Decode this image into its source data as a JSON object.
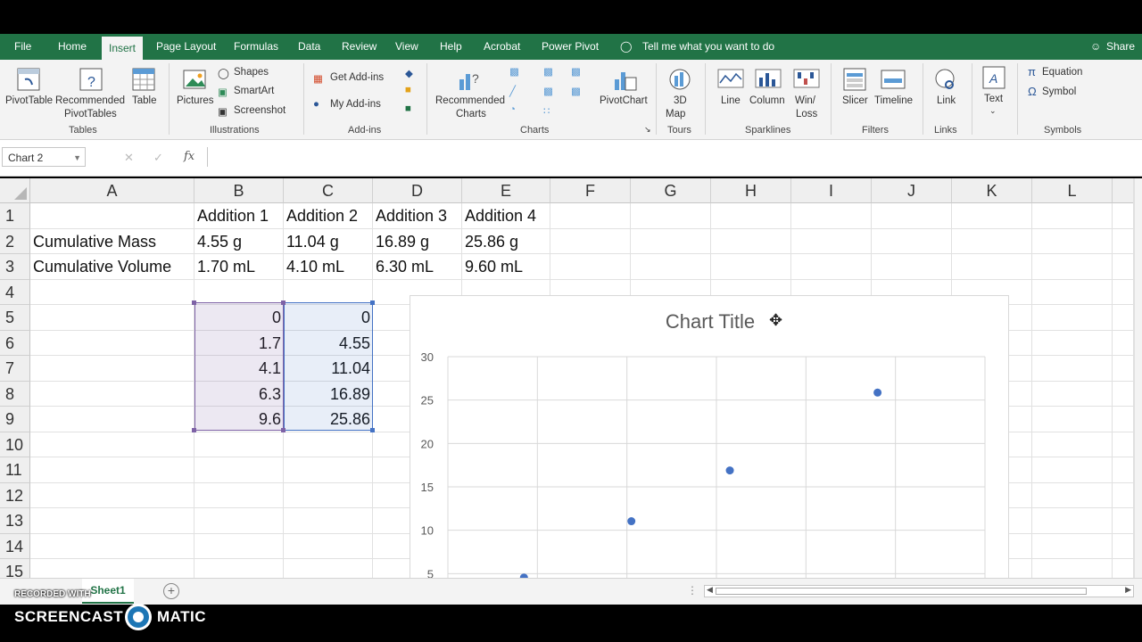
{
  "tabs": [
    "File",
    "Home",
    "Insert",
    "Page Layout",
    "Formulas",
    "Data",
    "Review",
    "View",
    "Help",
    "Acrobat",
    "Power Pivot"
  ],
  "active_tab": "Insert",
  "tell_me": "Tell me what you want to do",
  "share": "Share",
  "ribbon": {
    "tables": {
      "pivottable": "PivotTable",
      "recommended_pivot_1": "Recommended",
      "recommended_pivot_2": "PivotTables",
      "table": "Table",
      "group": "Tables"
    },
    "illustrations": {
      "pictures": "Pictures",
      "shapes": "Shapes",
      "smartart": "SmartArt",
      "screenshot": "Screenshot",
      "group": "Illustrations"
    },
    "addins": {
      "get": "Get Add-ins",
      "my": "My Add-ins",
      "group": "Add-ins"
    },
    "charts": {
      "recommended_1": "Recommended",
      "recommended_2": "Charts",
      "pivotchart": "PivotChart",
      "group": "Charts"
    },
    "tours": {
      "map_1": "3D",
      "map_2": "Map",
      "group": "Tours"
    },
    "sparklines": {
      "line": "Line",
      "column": "Column",
      "winloss_1": "Win/",
      "winloss_2": "Loss",
      "group": "Sparklines"
    },
    "filters": {
      "slicer": "Slicer",
      "timeline": "Timeline",
      "group": "Filters"
    },
    "links": {
      "link": "Link",
      "group": "Links"
    },
    "text": {
      "text": "Text"
    },
    "symbols": {
      "equation": "Equation",
      "symbol": "Symbol",
      "group": "Symbols"
    }
  },
  "formula_bar": {
    "name_box": "Chart 2",
    "fx": "fx",
    "cancel": "✕",
    "enter": "✓",
    "content": ""
  },
  "columns": [
    "A",
    "B",
    "C",
    "D",
    "E",
    "F",
    "G",
    "H",
    "I",
    "J",
    "K",
    "L"
  ],
  "rows": [
    "1",
    "2",
    "3",
    "4",
    "5",
    "6",
    "7",
    "8",
    "9",
    "10",
    "11",
    "12",
    "13",
    "14",
    "15"
  ],
  "cells": {
    "B1": "Addition 1",
    "C1": "Addition 2",
    "D1": "Addition 3",
    "E1": "Addition 4",
    "A2": "Cumulative Mass",
    "B2": "4.55 g",
    "C2": "11.04 g",
    "D2": "16.89 g",
    "E2": "25.86 g",
    "A3": "Cumulative Volume",
    "B3": "1.70 mL",
    "C3": "4.10 mL",
    "D3": "6.30 mL",
    "E3": "9.60 mL",
    "B5": "0",
    "C5": "0",
    "B6": "1.7",
    "C6": "4.55",
    "B7": "4.1",
    "C7": "11.04",
    "B8": "6.3",
    "C8": "16.89",
    "B9": "9.6",
    "C9": "25.86"
  },
  "chart_data": {
    "type": "scatter",
    "title": "Chart Title",
    "ylim": [
      0,
      30
    ],
    "xlim": [
      0,
      12
    ],
    "yticks": [
      "30",
      "25",
      "20",
      "15",
      "10",
      "5"
    ],
    "x": [
      0,
      1.7,
      4.1,
      6.3,
      9.6
    ],
    "y": [
      0,
      4.55,
      11.04,
      16.89,
      25.86
    ],
    "grid": true,
    "color": "#4472c4"
  },
  "sheet_tab": "Sheet1",
  "watermark": {
    "recorded": "RECORDED WITH",
    "brand_left": "SCREENCAST",
    "brand_right": "MATIC"
  },
  "colors": {
    "excel_green": "#217346",
    "selection_purple": "#7e62a6",
    "selection_blue": "#4472c4"
  }
}
